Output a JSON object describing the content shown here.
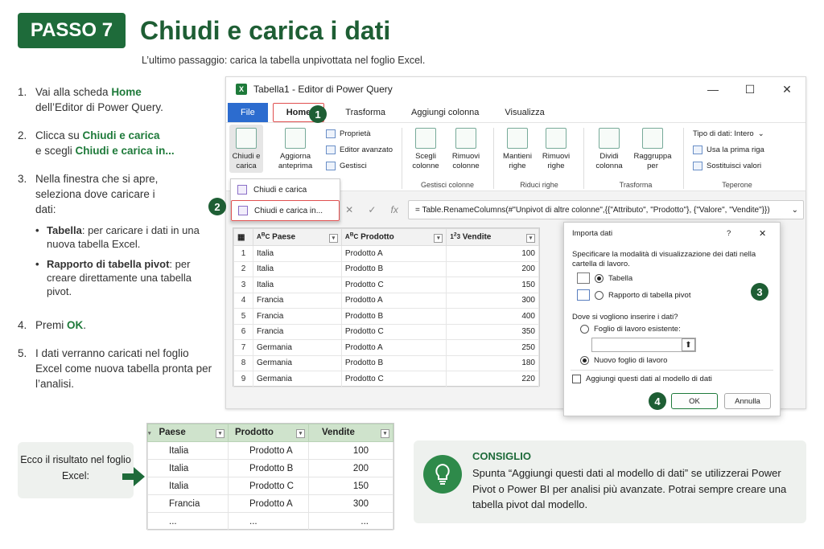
{
  "header": {
    "badge": "PASSO 7",
    "title": "Chiudi e carica i dati",
    "subtitle": "L’ultimo passaggio: carica la tabella unpivottata nel foglio Excel."
  },
  "steps": [
    {
      "num": "1.",
      "pre": "Vai alla scheda ",
      "bold": "Home",
      "post": " dell’Editor di Power Query."
    },
    {
      "num": "2.",
      "pre": "Clicca su ",
      "bold": "Chiudi e carica",
      "mid": " e scegli ",
      "bold2": "Chiudi e carica in..."
    },
    {
      "num": "3.",
      "text": "Nella finestra che si apre, seleziona dove caricare i dati:",
      "subs": [
        {
          "bold": "Tabella",
          "text": ": per caricare i dati in una nuova tabella Excel."
        },
        {
          "bold": "Rapporto di tabella pivot",
          "text": ": per creare direttamente una tabella pivot."
        }
      ]
    },
    {
      "num": "4.",
      "pre": "Premi ",
      "bold": "OK",
      "post": "."
    },
    {
      "num": "5.",
      "text": "I dati verranno caricati nel foglio Excel come nuova tabella pronta per l’analisi."
    }
  ],
  "window": {
    "title": "Tabella1 - Editor di Power Query",
    "tabs": [
      "File",
      "Home",
      "Trasforma",
      "Aggiungi colonna",
      "Visualizza"
    ]
  },
  "ribbon": {
    "close_load": "Chiudi e carica",
    "refresh": "Aggiorna anteprima",
    "properties": "Proprietà",
    "advanced_editor": "Editor avanzato",
    "manage": "Gestisci",
    "choose_cols": "Scegli colonne",
    "remove_cols": "Rimuovi colonne",
    "group_manage": "Gestisci colonne",
    "keep_rows": "Mantieni righe",
    "remove_rows": "Rimuovi righe",
    "group_reduce": "Riduci righe",
    "split_col": "Dividi colonna",
    "group_by": "Raggruppa per",
    "group_transform": "Trasforma",
    "data_type": "Tipo di dati: Intero",
    "first_row": "Usa la prima riga",
    "replace_values": "Sostituisci valori",
    "group_teperone": "Teperone"
  },
  "dropdown": {
    "item1": "Chiudi e carica",
    "item2": "Chiudi e carica in..."
  },
  "formula": "= Table.RenameColumns(#\"Unpivot di altre colonne\",{{\"Attributo\", \"Prodotto\"}, {\"Valore\", \"Vendite\"}})",
  "grid": {
    "headers": [
      "Paese",
      "Prodotto",
      "Vendite"
    ],
    "rows": [
      [
        "1",
        "Italia",
        "Prodotto A",
        "100"
      ],
      [
        "2",
        "Italia",
        "Prodotto B",
        "200"
      ],
      [
        "3",
        "Italia",
        "Prodotto C",
        "150"
      ],
      [
        "4",
        "Francia",
        "Prodotto A",
        "300"
      ],
      [
        "5",
        "Francia",
        "Prodotto B",
        "400"
      ],
      [
        "6",
        "Francia",
        "Prodotto C",
        "350"
      ],
      [
        "7",
        "Germania",
        "Prodotto A",
        "250"
      ],
      [
        "8",
        "Germania",
        "Prodotto B",
        "180"
      ],
      [
        "9",
        "Germania",
        "Prodotto C",
        "220"
      ]
    ]
  },
  "dialog": {
    "title": "Importa dati",
    "help": "?",
    "close": "✕",
    "q1": "Specificare la modalità di visualizzazione dei dati nella cartella di lavoro.",
    "opt_table": "Tabella",
    "opt_pivot": "Rapporto di tabella pivot",
    "q2": "Dove si vogliono inserire i dati?",
    "opt_existing": "Foglio di lavoro esistente:",
    "opt_new": "Nuovo foglio di lavoro",
    "model": "Aggiungi questi dati al modello di dati",
    "ok": "OK",
    "cancel": "Annulla"
  },
  "callouts": [
    "1",
    "2",
    "3",
    "4"
  ],
  "result": {
    "label": "Ecco il risultato nel foglio Excel:",
    "headers": [
      "Paese",
      "Prodotto",
      "Vendite"
    ],
    "rows": [
      [
        "Italia",
        "Prodotto A",
        "100"
      ],
      [
        "Italia",
        "Prodotto B",
        "200"
      ],
      [
        "Italia",
        "Prodotto C",
        "150"
      ],
      [
        "Francia",
        "Prodotto A",
        "300"
      ],
      [
        "...",
        "...",
        "..."
      ]
    ]
  },
  "tip": {
    "heading": "CONSIGLIO",
    "text": "Spunta “Aggiungi questi dati al modello di dati” se utilizzerai Power Pivot o Power BI per analisi più avanzate. Potrai sempre creare una tabella pivot dal modello."
  },
  "colors": {
    "accent": "#1e6b3a",
    "highlight": "#e05050",
    "file_tab": "#2c6ccf"
  }
}
